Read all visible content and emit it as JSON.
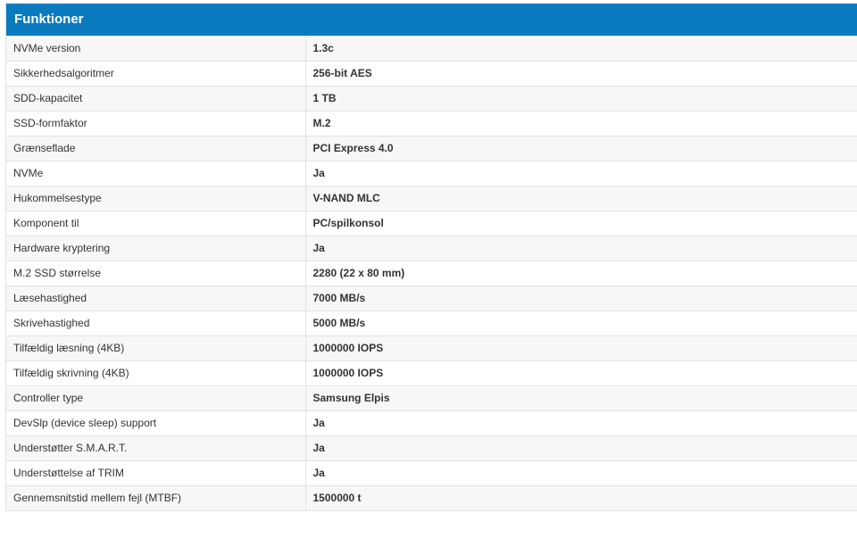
{
  "panel": {
    "title": "Funktioner",
    "header_color": "#0a7abf"
  },
  "specs": [
    {
      "label": "NVMe version",
      "value": "1.3c"
    },
    {
      "label": "Sikkerhedsalgoritmer",
      "value": "256-bit AES"
    },
    {
      "label": "SDD-kapacitet",
      "value": "1 TB"
    },
    {
      "label": "SSD-formfaktor",
      "value": "M.2"
    },
    {
      "label": "Grænseflade",
      "value": "PCI Express 4.0"
    },
    {
      "label": "NVMe",
      "value": "Ja"
    },
    {
      "label": "Hukommelsestype",
      "value": "V-NAND MLC"
    },
    {
      "label": "Komponent til",
      "value": "PC/spilkonsol"
    },
    {
      "label": "Hardware kryptering",
      "value": "Ja"
    },
    {
      "label": "M.2 SSD størrelse",
      "value": "2280 (22 x 80 mm)"
    },
    {
      "label": "Læsehastighed",
      "value": "7000 MB/s"
    },
    {
      "label": "Skrivehastighed",
      "value": "5000 MB/s"
    },
    {
      "label": "Tilfældig læsning (4KB)",
      "value": "1000000 IOPS"
    },
    {
      "label": "Tilfældig skrivning (4KB)",
      "value": "1000000 IOPS"
    },
    {
      "label": "Controller type",
      "value": "Samsung Elpis"
    },
    {
      "label": "DevSlp (device sleep) support",
      "value": "Ja"
    },
    {
      "label": "Understøtter S.M.A.R.T.",
      "value": "Ja"
    },
    {
      "label": "Understøttelse af TRIM",
      "value": "Ja"
    },
    {
      "label": "Gennemsnitstid mellem fejl (MTBF)",
      "value": "1500000 t"
    }
  ]
}
